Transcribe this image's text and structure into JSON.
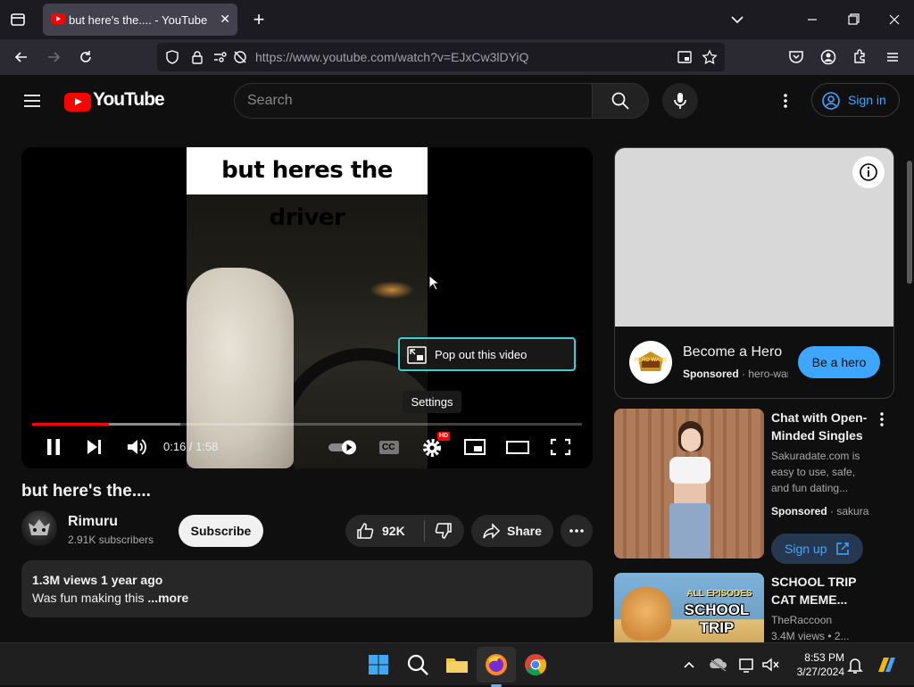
{
  "browser": {
    "tab_title": "but here's the.... - YouTube",
    "url": "https://www.youtube.com/watch?v=EJxCw3lDYiQ",
    "colors": {
      "tabbar": "#1c1b22",
      "toolbar": "#2b2a33",
      "tab_active": "#42414d"
    }
  },
  "youtube": {
    "logo_text": "YouTube",
    "search_placeholder": "Search",
    "sign_in": "Sign in",
    "player": {
      "overlay_caption": "but heres the driver",
      "popout_tooltip": "Pop out this video",
      "settings_tooltip": "Settings",
      "hd_badge": "HD",
      "cc_label": "CC",
      "time": "0:16 / 1:58",
      "progress_played_fraction": 0.14,
      "progress_buffered_fraction": 0.27
    },
    "video": {
      "title": "but here's the....",
      "channel_name": "Rimuru",
      "subscribers": "2.91K subscribers",
      "subscribe": "Subscribe",
      "likes": "92K",
      "share": "Share",
      "views_and_date": "1.3M views  1 year ago",
      "description": "Was fun making this",
      "more": "...more"
    },
    "ad": {
      "title": "Become a Hero",
      "sponsored": "Sponsored",
      "sponsor_domain": "hero-wars.com",
      "cta": "Be a hero",
      "logo_text": "HERO WARS"
    },
    "recommendations": [
      {
        "title": "Chat with Open-Minded Singles",
        "description": "Sakuradate.com is easy to use, safe, and fun dating...",
        "sponsored": "Sponsored",
        "sponsor_domain": "sakuradate.com",
        "cta": "Sign up"
      },
      {
        "title": "SCHOOL TRIP CAT MEME...",
        "channel": "TheRaccoon",
        "views": "3.4M views",
        "age": "2...",
        "thumb_text_top": "ALL EPISODES",
        "thumb_text_main": "SCHOOL TRIP"
      }
    ],
    "colors": {
      "accent_red": "#ff0000",
      "link_blue": "#3ea6ff",
      "bg": "#0f0f0f"
    }
  },
  "taskbar": {
    "time": "8:53 PM",
    "date": "3/27/2024"
  }
}
